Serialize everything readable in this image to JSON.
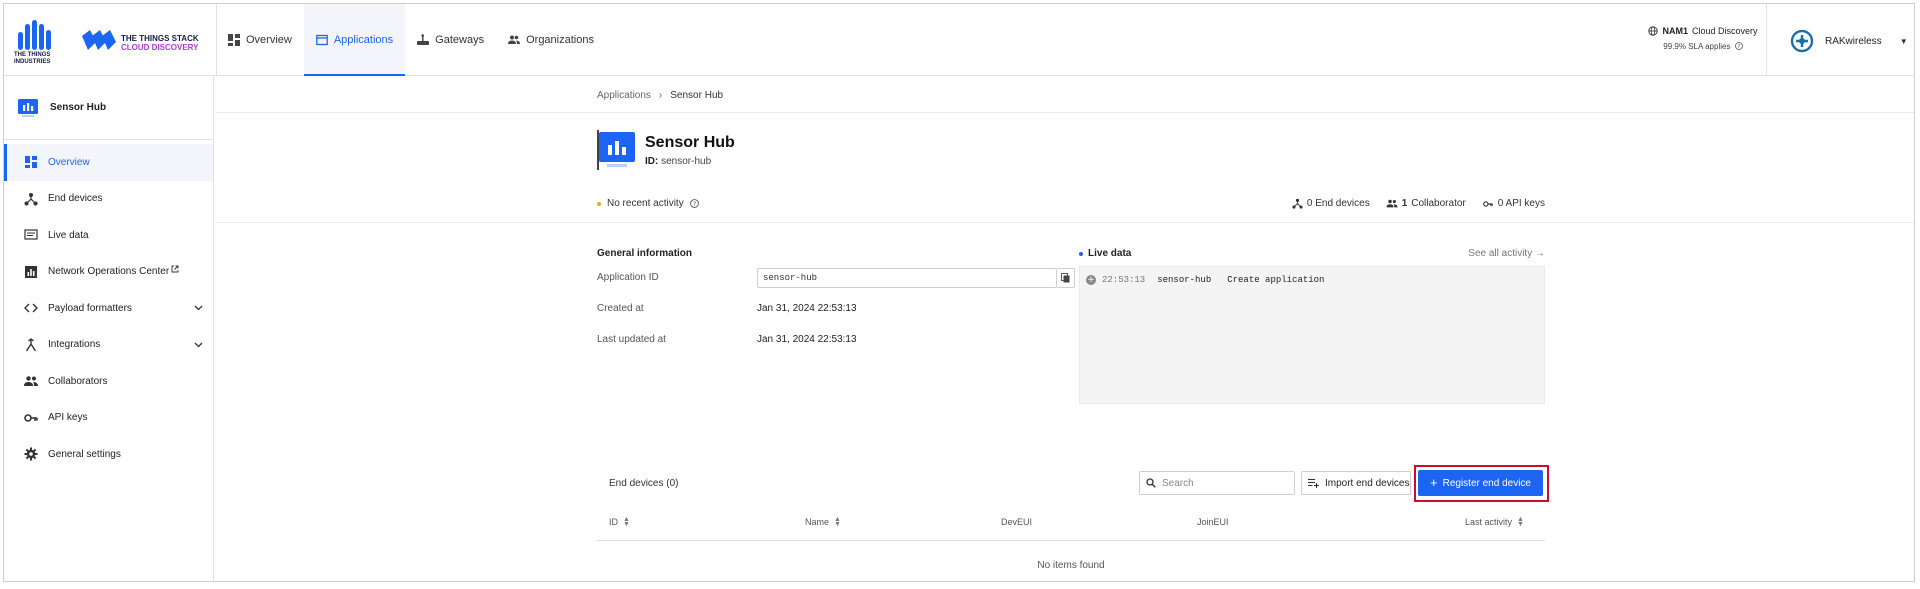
{
  "header": {
    "org_logo_text_1": "THE THINGS",
    "org_logo_text_2": "INDUSTRIES",
    "product_line_1": "THE THINGS STACK",
    "product_line_2": "CLOUD DISCOVERY",
    "nav": [
      {
        "label": "Overview",
        "icon": "dashboard-icon"
      },
      {
        "label": "Applications",
        "icon": "application-icon",
        "active": true
      },
      {
        "label": "Gateways",
        "icon": "gateway-icon"
      },
      {
        "label": "Organizations",
        "icon": "organization-icon"
      }
    ],
    "cluster_code": "NAM1",
    "cluster_name": "Cloud Discovery",
    "sla": "99.9% SLA applies",
    "user_name": "RAKwireless"
  },
  "sidebar": {
    "app_name": "Sensor Hub",
    "items": [
      {
        "label": "Overview",
        "icon": "dashboard-icon",
        "active": true
      },
      {
        "label": "End devices",
        "icon": "devices-icon"
      },
      {
        "label": "Live data",
        "icon": "live-data-icon"
      },
      {
        "label": "Network Operations Center",
        "icon": "chart-icon",
        "external": true
      },
      {
        "label": "Payload formatters",
        "icon": "code-icon",
        "expandable": true
      },
      {
        "label": "Integrations",
        "icon": "integration-icon",
        "expandable": true
      },
      {
        "label": "Collaborators",
        "icon": "people-icon"
      },
      {
        "label": "API keys",
        "icon": "key-icon"
      },
      {
        "label": "General settings",
        "icon": "gear-icon"
      }
    ]
  },
  "breadcrumb": {
    "parent": "Applications",
    "current": "Sensor Hub"
  },
  "app": {
    "title": "Sensor Hub",
    "id_label": "ID:",
    "id_value": "sensor-hub",
    "activity": "No recent activity",
    "stats": {
      "end_devices": "0 End devices",
      "collaborators_count": "1",
      "collaborators_label": "Collaborator",
      "api_keys": "0 API keys"
    }
  },
  "general_info": {
    "title": "General information",
    "application_id_label": "Application ID",
    "application_id_value": "sensor-hub",
    "created_label": "Created at",
    "created_value": "Jan 31, 2024 22:53:13",
    "updated_label": "Last updated at",
    "updated_value": "Jan 31, 2024 22:53:13"
  },
  "live_data": {
    "title": "Live data",
    "see_all": "See all activity →",
    "events": [
      {
        "time": "22:53:13",
        "entity": "sensor-hub",
        "type": "Create application"
      }
    ]
  },
  "end_devices": {
    "title": "End devices (0)",
    "search_placeholder": "Search",
    "import_label": "Import end devices",
    "register_label": "Register end device",
    "columns": [
      "ID",
      "Name",
      "DevEUI",
      "JoinEUI",
      "Last activity"
    ],
    "empty": "No items found"
  },
  "colors": {
    "accent": "#1c64f2",
    "highlight": "#c8102e",
    "activity_dot": "#f5a623"
  }
}
